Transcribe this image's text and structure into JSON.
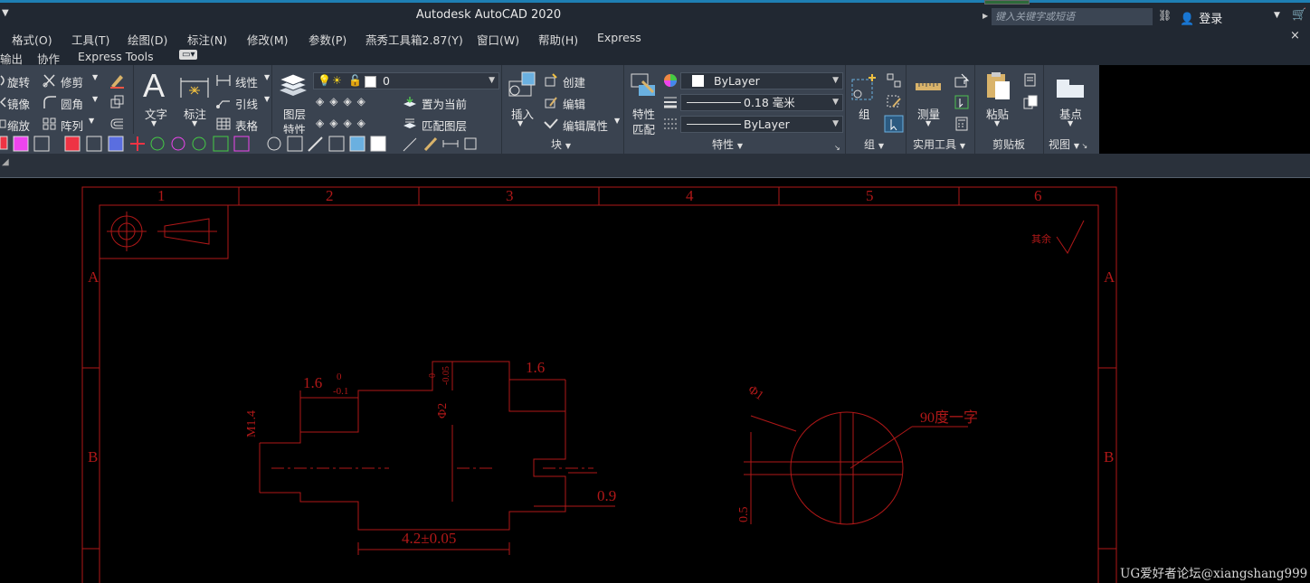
{
  "titlebar": {
    "app_title": "Autodesk AutoCAD 2020",
    "search_placeholder": "键入关键字或短语",
    "login_label": "登录"
  },
  "menubar": {
    "items": [
      "格式(O)",
      "工具(T)",
      "绘图(D)",
      "标注(N)",
      "修改(M)",
      "参数(P)",
      "燕秀工具箱2.87(Y)",
      "窗口(W)",
      "帮助(H)",
      "Express"
    ]
  },
  "tabs": [
    "输出",
    "协作",
    "Express Tools"
  ],
  "ribbon": {
    "modify": {
      "rotate": "旋转",
      "trim": "修剪",
      "mirror": "镜像",
      "fillet": "圆角",
      "scale": "缩放",
      "array": "阵列"
    },
    "annotation": {
      "text": "文字",
      "dimension": "标注",
      "linear": "线性",
      "leader": "引线",
      "table": "表格"
    },
    "layers": {
      "layer_props_line1": "图层",
      "layer_props_line2": "特性",
      "current_layer": "0",
      "make_current": "置为当前",
      "match_layer": "匹配图层"
    },
    "block": {
      "insert": "插入",
      "create": "创建",
      "edit": "编辑",
      "edit_attributes": "编辑属性",
      "panel_title": "块"
    },
    "properties": {
      "match_line1": "特性",
      "match_line2": "匹配",
      "color": "ByLayer",
      "lineweight": "0.18 毫米",
      "linetype": "ByLayer",
      "panel_title": "特性"
    },
    "groups": {
      "group": "组",
      "panel_title": "组"
    },
    "utilities": {
      "measure": "测量",
      "panel_title": "实用工具"
    },
    "clipboard": {
      "paste": "粘贴",
      "panel_title": "剪贴板"
    },
    "view": {
      "base": "基点",
      "panel_title": "视图"
    }
  },
  "drawing": {
    "column_labels": [
      "1",
      "2",
      "3",
      "4",
      "5",
      "6"
    ],
    "row_labels": [
      "A",
      "B"
    ],
    "dims": {
      "d1": "1.6",
      "d1_tol_up": "0",
      "d1_tol_down": "-0.1",
      "d2": "1.6",
      "thread": "M1.4",
      "dia": "Φ2",
      "dia_tol_up": "0",
      "dia_tol_down": "-0.05",
      "len": "4.2±0.05",
      "d09": "0.9",
      "d05": "0.5",
      "phi": "Φ1",
      "slot": "90度一字",
      "surface": "其余"
    }
  },
  "watermark": "UG爱好者论坛@xiangshang999",
  "colors": {
    "drawing": "#b01818",
    "ribbon_bg": "#3a4350",
    "titlebar_bg": "#212832",
    "accent": "#1e7fb4"
  }
}
